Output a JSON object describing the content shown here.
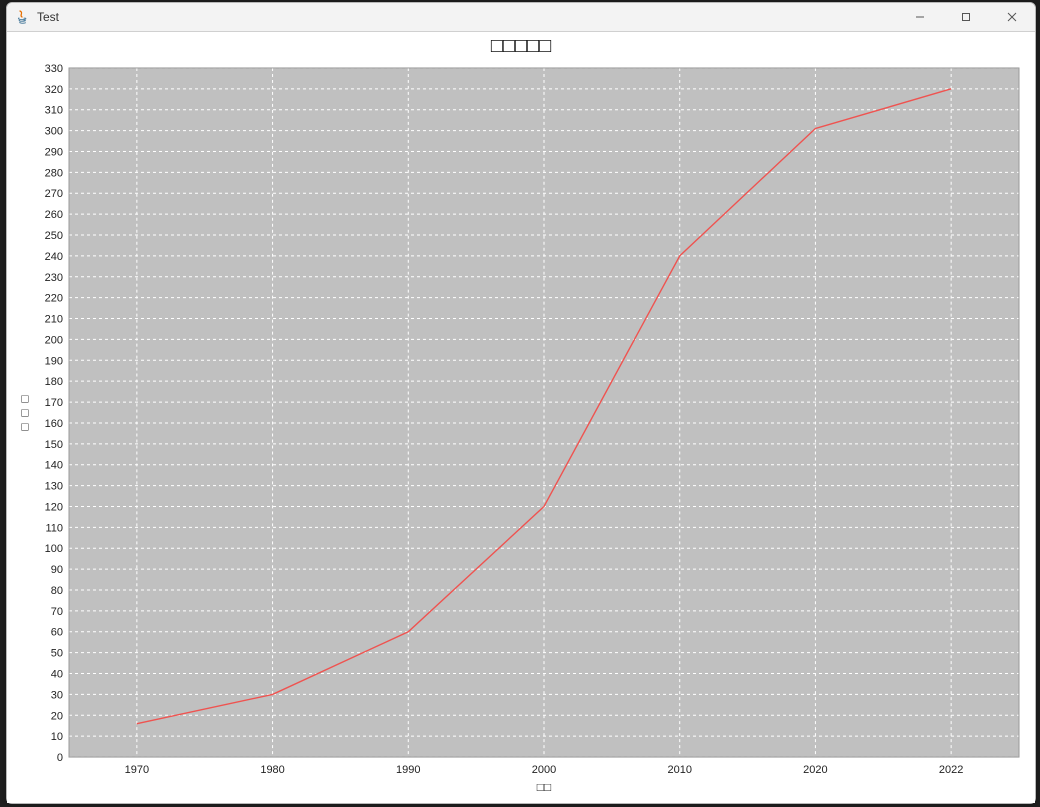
{
  "window": {
    "title": "Test"
  },
  "chart_data": {
    "type": "line",
    "title": "□□□□□",
    "xlabel": "□□",
    "ylabel": "□\n□\n□",
    "x_categories": [
      "1970",
      "1980",
      "1990",
      "2000",
      "2010",
      "2020",
      "2022"
    ],
    "values": [
      16,
      30,
      60,
      120,
      240,
      301,
      320
    ],
    "ylim": [
      0,
      330
    ],
    "y_ticks": [
      0,
      10,
      20,
      30,
      40,
      50,
      60,
      70,
      80,
      90,
      100,
      110,
      120,
      130,
      140,
      150,
      160,
      170,
      180,
      190,
      200,
      210,
      220,
      230,
      240,
      250,
      260,
      270,
      280,
      290,
      300,
      310,
      320,
      330
    ]
  }
}
